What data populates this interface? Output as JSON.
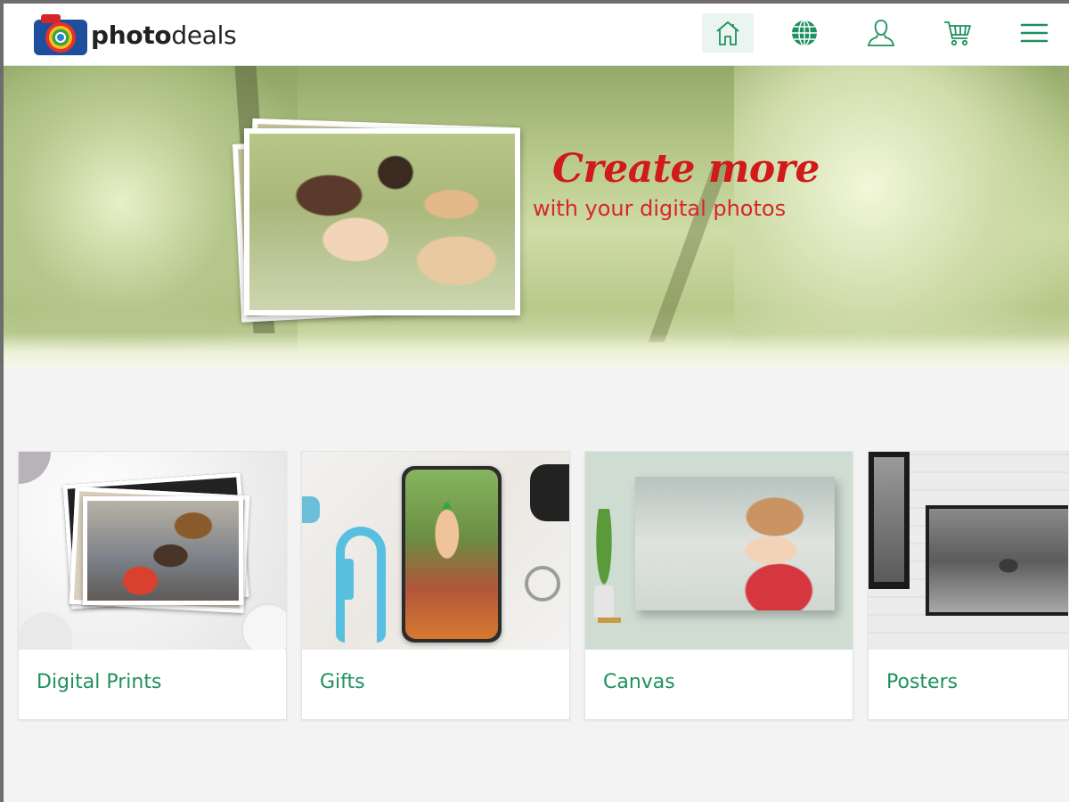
{
  "header": {
    "logo_light": "photo",
    "logo_bold": "deals",
    "nav": [
      {
        "name": "home-icon",
        "active": true
      },
      {
        "name": "globe-icon",
        "active": false
      },
      {
        "name": "user-icon",
        "active": false
      },
      {
        "name": "cart-icon",
        "active": false
      },
      {
        "name": "menu-icon",
        "active": false
      }
    ],
    "accent": "#1f9060"
  },
  "hero": {
    "title": "Create more",
    "subtitle": "with your digital photos",
    "title_color": "#d11a1a"
  },
  "categories": [
    {
      "label": "Digital Prints"
    },
    {
      "label": "Gifts"
    },
    {
      "label": "Canvas"
    },
    {
      "label": "Posters"
    }
  ]
}
